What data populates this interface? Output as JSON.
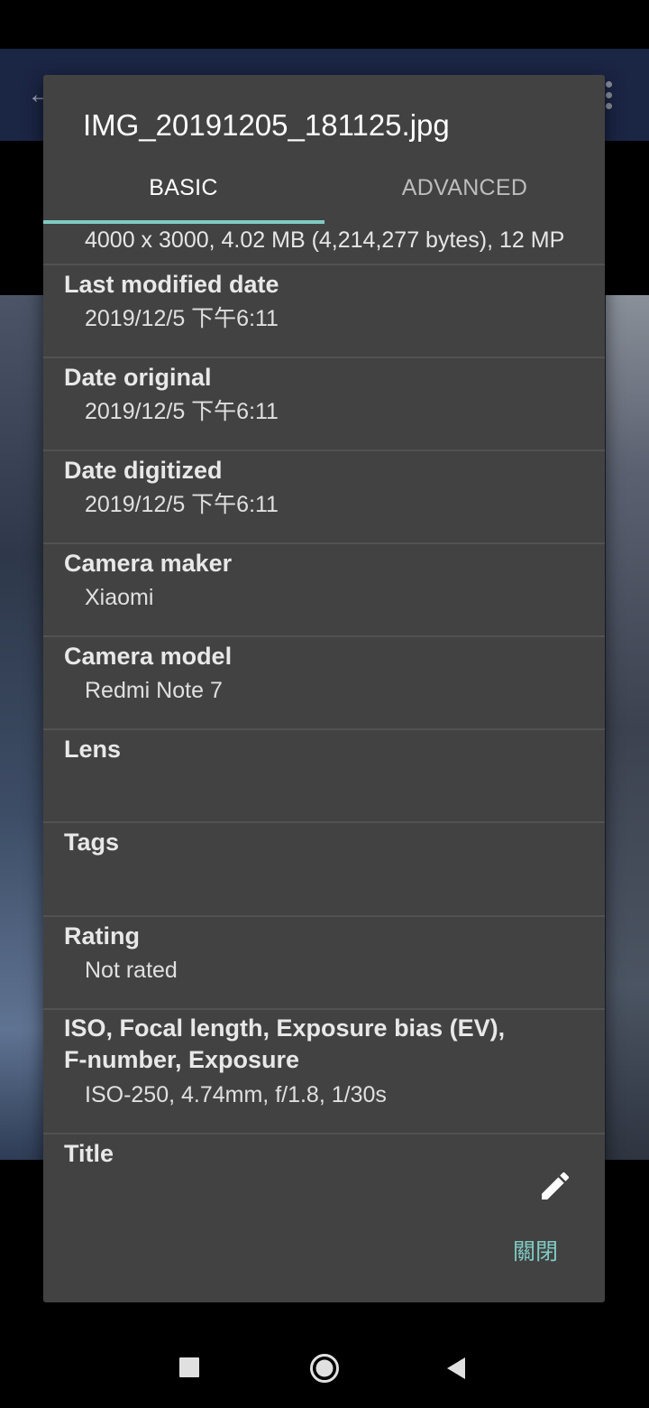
{
  "dialog": {
    "title": "IMG_20191205_181125.jpg",
    "tabs": [
      {
        "label": "BASIC"
      },
      {
        "label": "ADVANCED"
      }
    ],
    "first_value": "4000 x 3000, 4.02 MB (4,214,277 bytes), 12 MP",
    "items": [
      {
        "label": "Last modified date",
        "value": "2019/12/5 下午6:11"
      },
      {
        "label": "Date original",
        "value": "2019/12/5 下午6:11"
      },
      {
        "label": "Date digitized",
        "value": "2019/12/5 下午6:11"
      },
      {
        "label": "Camera maker",
        "value": "Xiaomi"
      },
      {
        "label": "Camera model",
        "value": "Redmi Note 7"
      },
      {
        "label": "Lens",
        "value": ""
      },
      {
        "label": "Tags",
        "value": ""
      },
      {
        "label": "Rating",
        "value": "Not rated"
      },
      {
        "label_line1": "ISO, Focal length, Exposure bias (EV),",
        "label_line2": "F-number, Exposure",
        "value": "ISO-250, 4.74mm, f/1.8, 1/30s"
      },
      {
        "label": "Title",
        "value": ""
      }
    ],
    "close_label": "關閉",
    "accent_color": "#80cbc4",
    "edit_icon": "pencil-icon"
  },
  "navbar": {
    "icons": [
      "recent-apps-icon",
      "home-icon",
      "back-icon"
    ]
  }
}
